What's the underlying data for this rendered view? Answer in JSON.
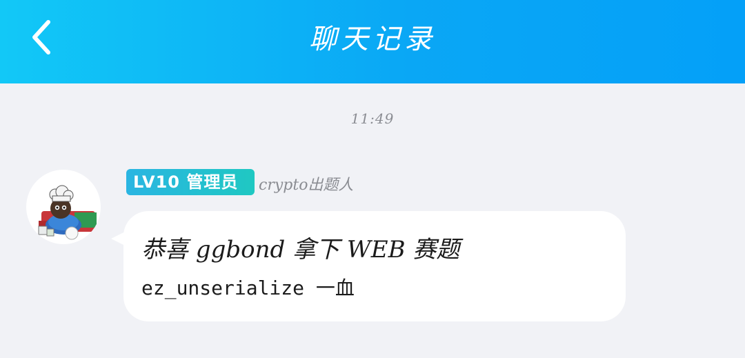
{
  "header": {
    "title": "聊天记录",
    "back_icon": "chevron-left-icon"
  },
  "timestamp": "11:49",
  "message": {
    "level_badge": "LV10 管理员",
    "sender": "crypto出题人",
    "avatar_icon": "chef-avatar-icon",
    "lines": [
      "恭喜 ggbond 拿下 WEB 赛题",
      "ez_unserialize 一血"
    ]
  },
  "colors": {
    "header_start": "#12c8f7",
    "header_end": "#04a0f8",
    "badge_start": "#2ab5e2",
    "badge_end": "#1fc8c2",
    "background": "#f1f2f6"
  }
}
